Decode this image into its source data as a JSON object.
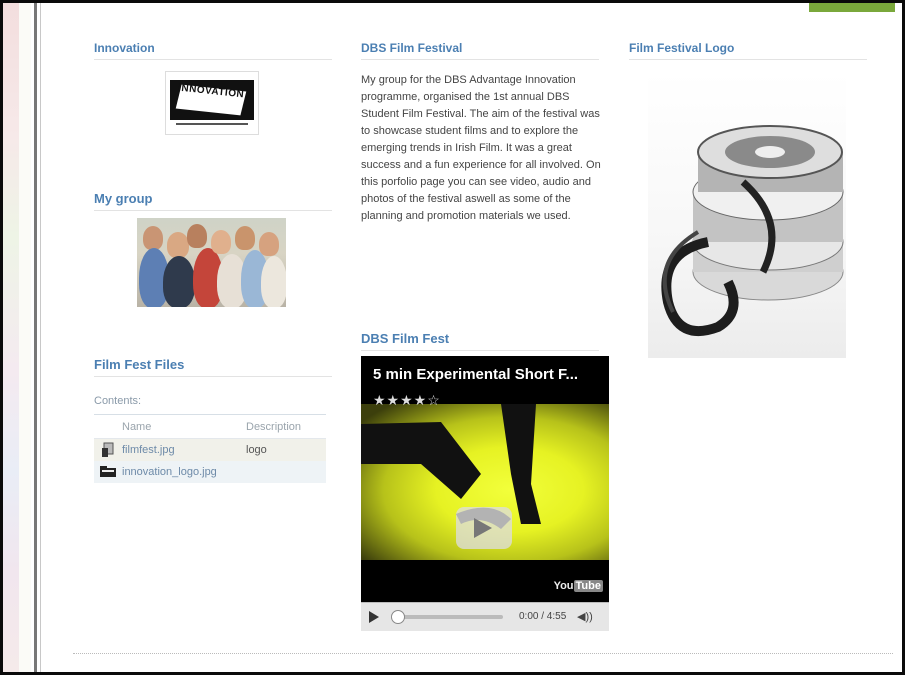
{
  "innovation": {
    "heading": "Innovation",
    "logo_text": "INNOVATION"
  },
  "my_group": {
    "heading": "My group"
  },
  "film_fest_files": {
    "heading": "Film Fest Files",
    "contents_label": "Contents:",
    "columns": [
      "Name",
      "Description"
    ],
    "rows": [
      {
        "icon": "image-file-icon",
        "name": "filmfest.jpg",
        "description": "logo"
      },
      {
        "icon": "folder-file-icon",
        "name": "innovation_logo.jpg",
        "description": ""
      }
    ]
  },
  "dbs_film_festival": {
    "heading": "DBS Film Festival",
    "body": "My group for the DBS Advantage Innovation programme, organised the 1st annual DBS Student Film Festival. The aim of the festival was to showcase student films and to explore the emerging trends in Irish Film. It was a great success and a fun experience for all involved. On this porfolio page you can see video, audio and photos of the festival aswell as some of the planning and promotion materials we used."
  },
  "dbs_film_fest_video": {
    "heading": "DBS Film Fest",
    "video_title": "5 min Experimental Short F...",
    "rating_stars": "★★★★☆",
    "time": "0:00 / 4:55",
    "brand": "You"
  },
  "film_festival_logo": {
    "heading": "Film Festival Logo"
  }
}
